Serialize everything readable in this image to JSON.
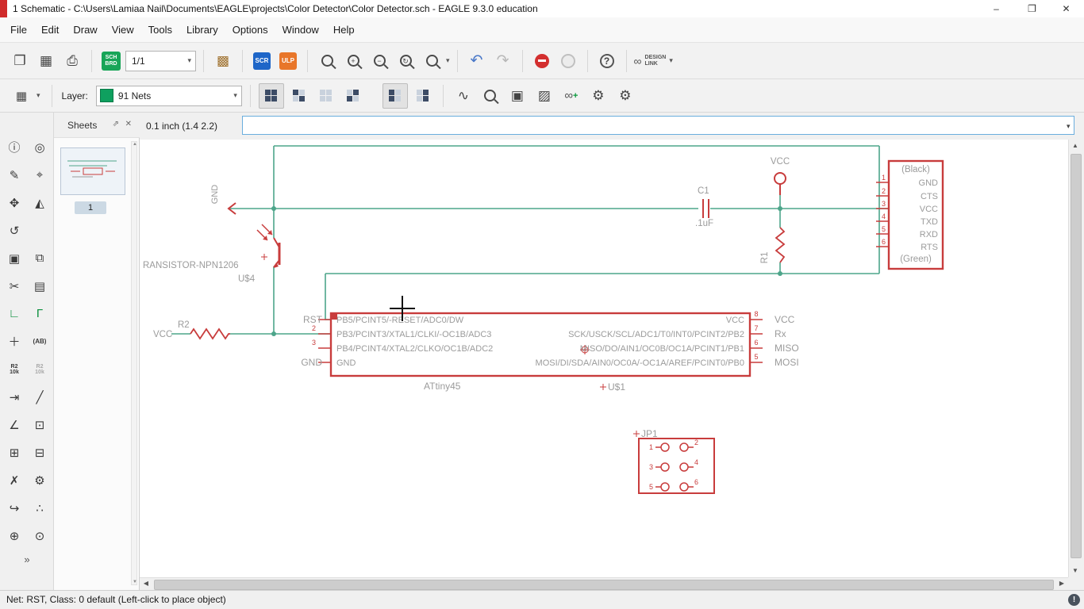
{
  "window": {
    "title": "1 Schematic - C:\\Users\\Lamiaa Nail\\Documents\\EAGLE\\projects\\Color Detector\\Color Detector.sch - EAGLE 9.3.0 education",
    "minimize": "–",
    "maximize": "❐",
    "close": "✕"
  },
  "menu": {
    "items": [
      "File",
      "Edit",
      "Draw",
      "View",
      "Tools",
      "Library",
      "Options",
      "Window",
      "Help"
    ]
  },
  "toolbar": {
    "sheet_value": "1/1",
    "scr": "SCR",
    "ulp": "ULP",
    "sch": "SCH",
    "brd": "BRD",
    "design": "DESIGN",
    "link": "LINK",
    "dropdown": "▾"
  },
  "icons": {
    "new": "❐",
    "save": "▦",
    "print": "⎙",
    "package": "▩",
    "zoom_fit": "",
    "zoom_in": "+",
    "zoom_out": "−",
    "zoom_redraw": "↻",
    "zoom_select": "",
    "undo": "↶",
    "redo": "↷",
    "help": "?",
    "link": "∞",
    "link_plus": "+",
    "grid": "▦",
    "sine": "∿",
    "erc1": "▣",
    "erc2": "▨",
    "gear": "⚙",
    "panel_expand": "⇗",
    "panel_close": "✕",
    "chevron_more": "»",
    "scroll_up": "▲",
    "scroll_down": "▼",
    "scroll_left": "◀",
    "scroll_right": "▶",
    "warning": "!"
  },
  "toolbar2": {
    "layer_label": "Layer:",
    "layer_value": "91 Nets"
  },
  "left_tools": [
    {
      "name": "info-tool",
      "glyph": "ⓘ",
      "style": ""
    },
    {
      "name": "show-tool",
      "glyph": "◎",
      "style": ""
    },
    {
      "name": "display-tool",
      "glyph": "✎",
      "style": ""
    },
    {
      "name": "mark-tool",
      "glyph": "⌖",
      "style": ""
    },
    {
      "name": "move-tool",
      "glyph": "✥",
      "style": ""
    },
    {
      "name": "mirror-tool",
      "glyph": "◭",
      "style": ""
    },
    {
      "name": "rotate-tool",
      "glyph": "↺",
      "style": ""
    },
    {
      "name": "blank-tool",
      "glyph": "",
      "style": ""
    },
    {
      "name": "group-tool",
      "glyph": "▣",
      "style": ""
    },
    {
      "name": "change-tool",
      "glyph": "⧉",
      "style": ""
    },
    {
      "name": "cut-tool",
      "glyph": "✂",
      "style": ""
    },
    {
      "name": "paste-tool",
      "glyph": "▤",
      "style": ""
    },
    {
      "name": "wire-tool",
      "glyph": "∟",
      "style": "color:#0a8f3c"
    },
    {
      "name": "net-tool",
      "glyph": "Γ",
      "style": "color:#0a8f3c"
    },
    {
      "name": "junction-tool",
      "glyph": "＋",
      "style": ""
    },
    {
      "name": "label-tool",
      "glyph": "(AB)",
      "style": "font-size:8px;font-weight:bold"
    },
    {
      "name": "name-tool",
      "glyph": "R2\n10k",
      "style": "font-size:7px;font-weight:bold;line-height:7px"
    },
    {
      "name": "value-tool",
      "glyph": "R2\n10k",
      "style": "font-size:7px;font-weight:bold;line-height:7px;color:#a8a8a8"
    },
    {
      "name": "smash-tool",
      "glyph": "⇥",
      "style": ""
    },
    {
      "name": "split-tool",
      "glyph": "╱",
      "style": ""
    },
    {
      "name": "miter-tool",
      "glyph": "∠",
      "style": ""
    },
    {
      "name": "attribute-tool",
      "glyph": "⊡",
      "style": ""
    },
    {
      "name": "copy-tool",
      "glyph": "⊞",
      "style": ""
    },
    {
      "name": "clipboard-tool",
      "glyph": "⊟",
      "style": ""
    },
    {
      "name": "delete-tool",
      "glyph": "✗",
      "style": ""
    },
    {
      "name": "wrench-tool",
      "glyph": "⚙",
      "style": ""
    },
    {
      "name": "invoke-tool",
      "glyph": "↪",
      "style": ""
    },
    {
      "name": "dots-tool",
      "glyph": "∴",
      "style": ""
    },
    {
      "name": "bus-tool",
      "glyph": "⊕",
      "style": ""
    },
    {
      "name": "polygon-tool",
      "glyph": "⊙",
      "style": ""
    }
  ],
  "sheets": {
    "title": "Sheets",
    "page_label": "1"
  },
  "command": {
    "coords": "0.1 inch (1.4 2.2)",
    "value": ""
  },
  "status": {
    "text": "Net: RST, Class: 0 default (Left-click to place object)"
  },
  "colors": {
    "net": "#4da58a",
    "part": "#c83c3c",
    "label": "#9b9b9b",
    "layer_swatch": "#0fa05f"
  },
  "schematic": {
    "gnd_symbol": "GND",
    "transistor_label": "RANSISTOR-NPN1206",
    "transistor_ref": "U$4",
    "c1_name": "C1",
    "c1_value": ".1uF",
    "vcc_symbol": "VCC",
    "r1_name": "R1",
    "r2_vcc": "VCC",
    "r2_name": "R2",
    "rst_net": "RST",
    "gnd_net": "GND",
    "pin_2": "2",
    "pin_3": "3",
    "ic_left_pins": [
      "PB5/PCINT5/-RESET/ADC0/DW",
      "PB3/PCINT3/XTAL1/CLKI/-OC1B/ADC3",
      "PB4/PCINT4/XTAL2/CLKO/OC1B/ADC2",
      "GND"
    ],
    "ic_right_pins": [
      "VCC",
      "SCK/USCK/SCL/ADC1/T0/INT0/PCINT2/PB2",
      "MISO/DO/AIN1/OC0B/OC1A/PCINT1/PB1",
      "MOSI/DI/SDA/AIN0/OC0A/-OC1A/AREF/PCINT0/PB0"
    ],
    "ic_right_numbers": [
      "8",
      "7",
      "6",
      "5"
    ],
    "ic_right_nets": [
      "VCC",
      "Rx",
      "MISO",
      "MOSI"
    ],
    "ic_name": "ATtiny45",
    "ic_ref": "U$1",
    "conn_top": "(Black)",
    "conn_bottom": "(Green)",
    "conn_pins": [
      "GND",
      "CTS",
      "VCC",
      "TXD",
      "RXD",
      "RTS"
    ],
    "conn_numbers": [
      "1",
      "2",
      "3",
      "4",
      "5",
      "6"
    ],
    "jp_name": "JP1",
    "jp_numbers": [
      "1",
      "2",
      "3",
      "4",
      "5",
      "6"
    ]
  }
}
